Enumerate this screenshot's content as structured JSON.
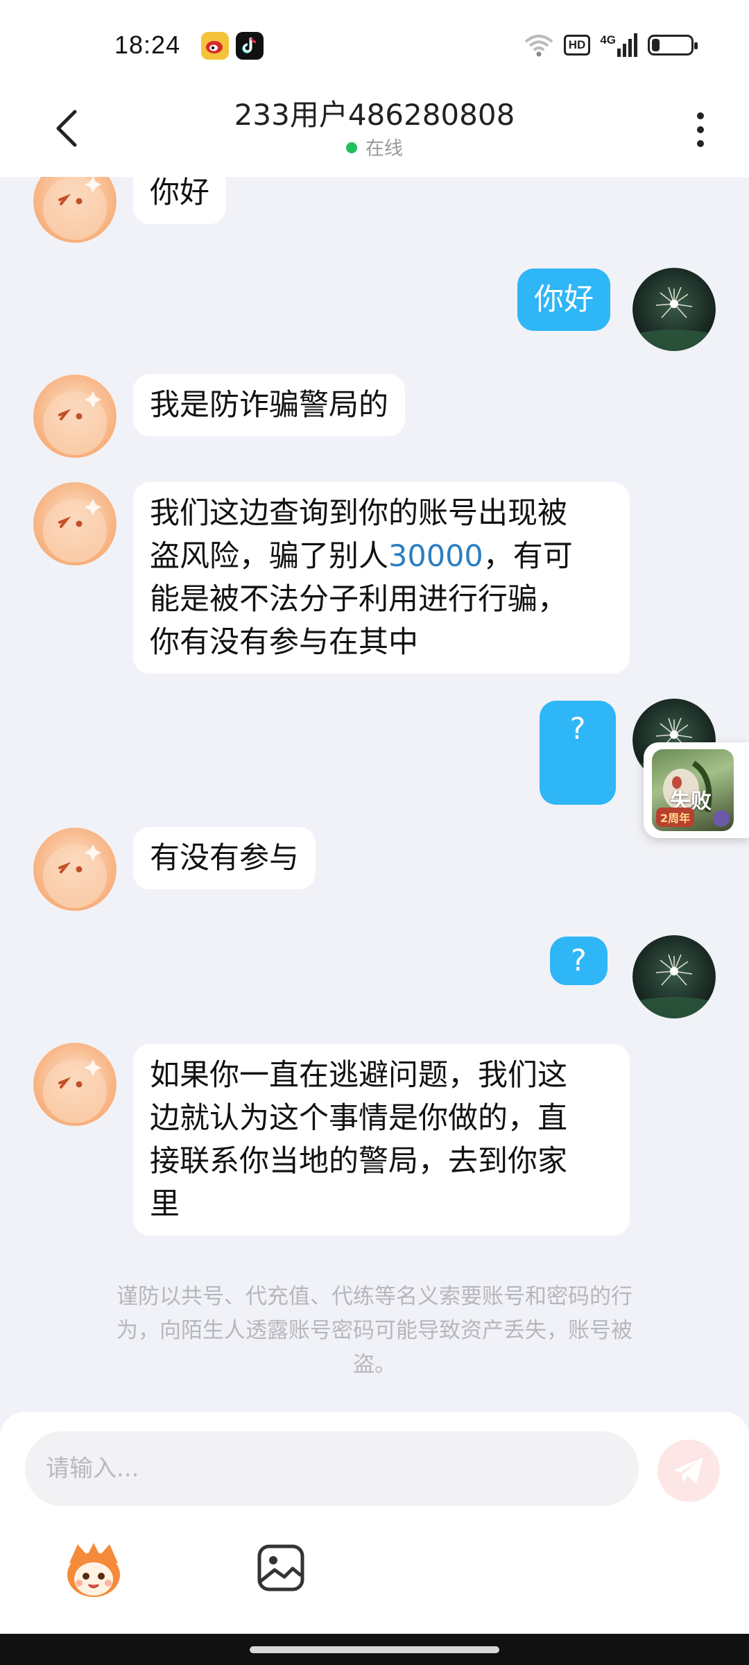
{
  "status_bar": {
    "time": "18:24",
    "icons": [
      "weibo-icon",
      "douyin-icon",
      "wifi-icon",
      "hd-badge",
      "signal-icon",
      "battery-icon"
    ],
    "hd_label": "HD",
    "network_label": "4G",
    "battery_level": 0.2
  },
  "header": {
    "title": "233用户486280808",
    "status": "在线",
    "status_color": "#21c05a"
  },
  "messages": [
    {
      "side": "left",
      "text": "你好"
    },
    {
      "side": "right",
      "text": "你好"
    },
    {
      "side": "left",
      "text": "我是防诈骗警局的"
    },
    {
      "side": "left",
      "text_parts": [
        "我们这边查询到你的账号出现被",
        "盗风险，骗了别人",
        "30000",
        "，有可",
        "能是被不法分子利用进行行骗，",
        "你有没有参与在其中"
      ]
    },
    {
      "side": "right",
      "text": "?"
    },
    {
      "side": "left",
      "text": "有没有参与"
    },
    {
      "side": "right",
      "text": "?"
    },
    {
      "side": "left",
      "lines": [
        "如果你一直在逃避问题，我们这",
        "边就认为这个事情是你做的，直",
        "接联系你当地的警局，去到你家",
        "里"
      ]
    }
  ],
  "floating_badge": {
    "label": "失败",
    "tag": "2周年"
  },
  "notice": {
    "lines": [
      "谨防以共号、代充值、代练等名义索要账号和密码的行",
      "为，向陌生人透露账号密码可能导致资产丢失，账号被",
      "盗。"
    ]
  },
  "input": {
    "placeholder": "请输入..."
  },
  "colors": {
    "bubble_right": "#2fb6f6",
    "bubble_left": "#ffffff",
    "highlight_number": "#2b7ec1",
    "background": "#f1f2f7"
  }
}
